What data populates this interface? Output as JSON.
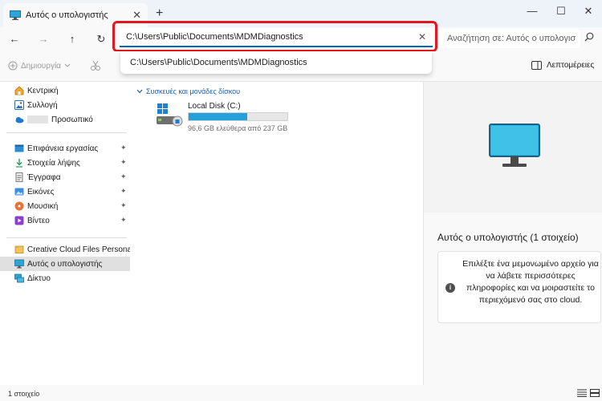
{
  "window": {
    "tab_title": "Αυτός ο υπολογιστής",
    "tab_close": "✕",
    "new_tab": "+",
    "minimize": "—",
    "maximize": "☐",
    "close": "✕"
  },
  "navigation": {
    "back": "←",
    "forward": "→",
    "up": "↑",
    "refresh": "↻",
    "address_value": "C:\\Users\\Public\\Documents\\MDMDiagnostics",
    "address_clear": "✕",
    "suggestion": "C:\\Users\\Public\\Documents\\MDMDiagnostics",
    "search_placeholder": "Αναζήτηση σε: Αυτός ο υπολογισ"
  },
  "toolbar": {
    "new_label": "Δημιουργία",
    "details_label": "Λεπτομέρειες"
  },
  "sidebar": {
    "items": [
      {
        "label": "Κεντρική",
        "icon": "home-icon"
      },
      {
        "label": "Συλλογή",
        "icon": "gallery-icon"
      },
      {
        "label": "Προσωπικό",
        "icon": "onedrive-icon"
      },
      {
        "label": "Επιφάνεια εργασίας",
        "icon": "desktop-icon",
        "pinned": true
      },
      {
        "label": "Στοιχεία λήψης",
        "icon": "downloads-icon",
        "pinned": true
      },
      {
        "label": "Έγγραφα",
        "icon": "documents-icon",
        "pinned": true
      },
      {
        "label": "Εικόνες",
        "icon": "pictures-icon",
        "pinned": true
      },
      {
        "label": "Μουσική",
        "icon": "music-icon",
        "pinned": true
      },
      {
        "label": "Βίντεο",
        "icon": "videos-icon",
        "pinned": true
      },
      {
        "label": "Creative Cloud Files Personal Acc",
        "icon": "creative-cloud-icon"
      },
      {
        "label": "Αυτός ο υπολογιστής",
        "icon": "this-pc-icon",
        "selected": true
      },
      {
        "label": "Δίκτυο",
        "icon": "network-icon"
      }
    ]
  },
  "content": {
    "group_header": "Συσκευές και μονάδες δίσκου",
    "drive": {
      "name": "Local Disk (C:)",
      "free_text": "96,6 GB ελεύθερα από 237 GB",
      "used_fraction": 0.59
    }
  },
  "details_pane": {
    "title": "Αυτός ο υπολογιστής (1 στοιχείο)",
    "info_text": "Επιλέξτε ένα μεμονωμένο αρχείο για να λάβετε περισσότερες πληροφορίες και να μοιραστείτε το περιεχόμενό σας στο cloud.",
    "info_glyph": "i"
  },
  "statusbar": {
    "item_count": "1 στοιχείο"
  },
  "colors": {
    "accent": "#0067c0",
    "highlight_border": "#e1191e",
    "drive_bar_fill": "#26a0da"
  }
}
